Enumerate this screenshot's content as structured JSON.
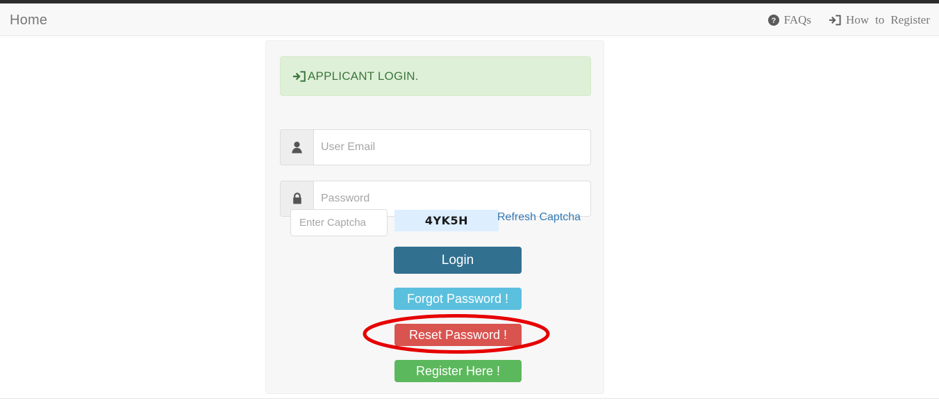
{
  "navbar": {
    "brand": "Home",
    "links": [
      {
        "icon": "question-circle-icon",
        "label": "FAQs",
        "words": [
          "FAQs"
        ]
      },
      {
        "icon": "sign-in-icon",
        "label": "How to Register",
        "words": [
          "How",
          "to",
          "Register"
        ]
      }
    ]
  },
  "login_card": {
    "alert": {
      "icon": "sign-in-icon",
      "text": "APPLICANT LOGIN."
    },
    "fields": {
      "email": {
        "icon": "user-icon",
        "placeholder": "User Email",
        "value": ""
      },
      "password": {
        "icon": "lock-icon",
        "placeholder": "Password",
        "value": ""
      }
    },
    "captcha": {
      "input_placeholder": "Enter Captcha",
      "input_value": "",
      "code": "4YK5H",
      "refresh_label": "Refresh Captcha"
    },
    "buttons": {
      "login": "Login",
      "forgot": "Forgot Password !",
      "reset": "Reset Password !",
      "register": "Register Here !"
    }
  },
  "annotation": {
    "shape": "ellipse",
    "target": "Reset Password !",
    "color": "#e60000"
  },
  "colors": {
    "top_strip": "#2c2c2c",
    "navbar_bg": "#f8f8f8",
    "card_bg": "#f7f7f7",
    "alert_bg": "#dff0d8",
    "alert_text": "#3c763d",
    "captcha_bg": "#ddeeff",
    "link": "#337ab7",
    "btn_login": "#31708f",
    "btn_forgot": "#5bc0de",
    "btn_reset": "#d9534f",
    "btn_register": "#5cb85c"
  }
}
